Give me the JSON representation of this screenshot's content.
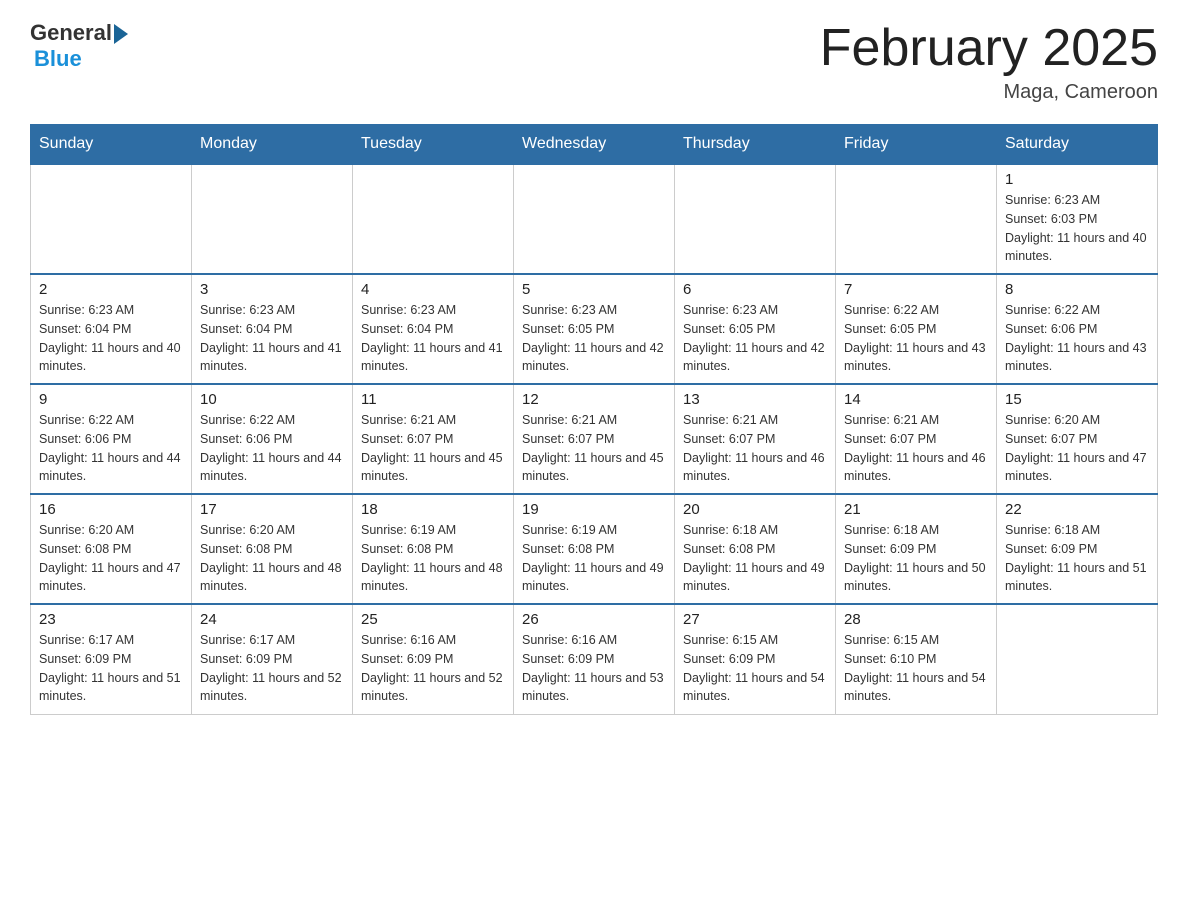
{
  "header": {
    "logo_general": "General",
    "logo_blue": "Blue",
    "month_title": "February 2025",
    "location": "Maga, Cameroon"
  },
  "calendar": {
    "days_of_week": [
      "Sunday",
      "Monday",
      "Tuesday",
      "Wednesday",
      "Thursday",
      "Friday",
      "Saturday"
    ],
    "weeks": [
      {
        "days": [
          {
            "number": "",
            "empty": true
          },
          {
            "number": "",
            "empty": true
          },
          {
            "number": "",
            "empty": true
          },
          {
            "number": "",
            "empty": true
          },
          {
            "number": "",
            "empty": true
          },
          {
            "number": "",
            "empty": true
          },
          {
            "number": "1",
            "sunrise": "Sunrise: 6:23 AM",
            "sunset": "Sunset: 6:03 PM",
            "daylight": "Daylight: 11 hours and 40 minutes."
          }
        ]
      },
      {
        "days": [
          {
            "number": "2",
            "sunrise": "Sunrise: 6:23 AM",
            "sunset": "Sunset: 6:04 PM",
            "daylight": "Daylight: 11 hours and 40 minutes."
          },
          {
            "number": "3",
            "sunrise": "Sunrise: 6:23 AM",
            "sunset": "Sunset: 6:04 PM",
            "daylight": "Daylight: 11 hours and 41 minutes."
          },
          {
            "number": "4",
            "sunrise": "Sunrise: 6:23 AM",
            "sunset": "Sunset: 6:04 PM",
            "daylight": "Daylight: 11 hours and 41 minutes."
          },
          {
            "number": "5",
            "sunrise": "Sunrise: 6:23 AM",
            "sunset": "Sunset: 6:05 PM",
            "daylight": "Daylight: 11 hours and 42 minutes."
          },
          {
            "number": "6",
            "sunrise": "Sunrise: 6:23 AM",
            "sunset": "Sunset: 6:05 PM",
            "daylight": "Daylight: 11 hours and 42 minutes."
          },
          {
            "number": "7",
            "sunrise": "Sunrise: 6:22 AM",
            "sunset": "Sunset: 6:05 PM",
            "daylight": "Daylight: 11 hours and 43 minutes."
          },
          {
            "number": "8",
            "sunrise": "Sunrise: 6:22 AM",
            "sunset": "Sunset: 6:06 PM",
            "daylight": "Daylight: 11 hours and 43 minutes."
          }
        ]
      },
      {
        "days": [
          {
            "number": "9",
            "sunrise": "Sunrise: 6:22 AM",
            "sunset": "Sunset: 6:06 PM",
            "daylight": "Daylight: 11 hours and 44 minutes."
          },
          {
            "number": "10",
            "sunrise": "Sunrise: 6:22 AM",
            "sunset": "Sunset: 6:06 PM",
            "daylight": "Daylight: 11 hours and 44 minutes."
          },
          {
            "number": "11",
            "sunrise": "Sunrise: 6:21 AM",
            "sunset": "Sunset: 6:07 PM",
            "daylight": "Daylight: 11 hours and 45 minutes."
          },
          {
            "number": "12",
            "sunrise": "Sunrise: 6:21 AM",
            "sunset": "Sunset: 6:07 PM",
            "daylight": "Daylight: 11 hours and 45 minutes."
          },
          {
            "number": "13",
            "sunrise": "Sunrise: 6:21 AM",
            "sunset": "Sunset: 6:07 PM",
            "daylight": "Daylight: 11 hours and 46 minutes."
          },
          {
            "number": "14",
            "sunrise": "Sunrise: 6:21 AM",
            "sunset": "Sunset: 6:07 PM",
            "daylight": "Daylight: 11 hours and 46 minutes."
          },
          {
            "number": "15",
            "sunrise": "Sunrise: 6:20 AM",
            "sunset": "Sunset: 6:07 PM",
            "daylight": "Daylight: 11 hours and 47 minutes."
          }
        ]
      },
      {
        "days": [
          {
            "number": "16",
            "sunrise": "Sunrise: 6:20 AM",
            "sunset": "Sunset: 6:08 PM",
            "daylight": "Daylight: 11 hours and 47 minutes."
          },
          {
            "number": "17",
            "sunrise": "Sunrise: 6:20 AM",
            "sunset": "Sunset: 6:08 PM",
            "daylight": "Daylight: 11 hours and 48 minutes."
          },
          {
            "number": "18",
            "sunrise": "Sunrise: 6:19 AM",
            "sunset": "Sunset: 6:08 PM",
            "daylight": "Daylight: 11 hours and 48 minutes."
          },
          {
            "number": "19",
            "sunrise": "Sunrise: 6:19 AM",
            "sunset": "Sunset: 6:08 PM",
            "daylight": "Daylight: 11 hours and 49 minutes."
          },
          {
            "number": "20",
            "sunrise": "Sunrise: 6:18 AM",
            "sunset": "Sunset: 6:08 PM",
            "daylight": "Daylight: 11 hours and 49 minutes."
          },
          {
            "number": "21",
            "sunrise": "Sunrise: 6:18 AM",
            "sunset": "Sunset: 6:09 PM",
            "daylight": "Daylight: 11 hours and 50 minutes."
          },
          {
            "number": "22",
            "sunrise": "Sunrise: 6:18 AM",
            "sunset": "Sunset: 6:09 PM",
            "daylight": "Daylight: 11 hours and 51 minutes."
          }
        ]
      },
      {
        "days": [
          {
            "number": "23",
            "sunrise": "Sunrise: 6:17 AM",
            "sunset": "Sunset: 6:09 PM",
            "daylight": "Daylight: 11 hours and 51 minutes."
          },
          {
            "number": "24",
            "sunrise": "Sunrise: 6:17 AM",
            "sunset": "Sunset: 6:09 PM",
            "daylight": "Daylight: 11 hours and 52 minutes."
          },
          {
            "number": "25",
            "sunrise": "Sunrise: 6:16 AM",
            "sunset": "Sunset: 6:09 PM",
            "daylight": "Daylight: 11 hours and 52 minutes."
          },
          {
            "number": "26",
            "sunrise": "Sunrise: 6:16 AM",
            "sunset": "Sunset: 6:09 PM",
            "daylight": "Daylight: 11 hours and 53 minutes."
          },
          {
            "number": "27",
            "sunrise": "Sunrise: 6:15 AM",
            "sunset": "Sunset: 6:09 PM",
            "daylight": "Daylight: 11 hours and 54 minutes."
          },
          {
            "number": "28",
            "sunrise": "Sunrise: 6:15 AM",
            "sunset": "Sunset: 6:10 PM",
            "daylight": "Daylight: 11 hours and 54 minutes."
          },
          {
            "number": "",
            "empty": true
          }
        ]
      }
    ]
  }
}
